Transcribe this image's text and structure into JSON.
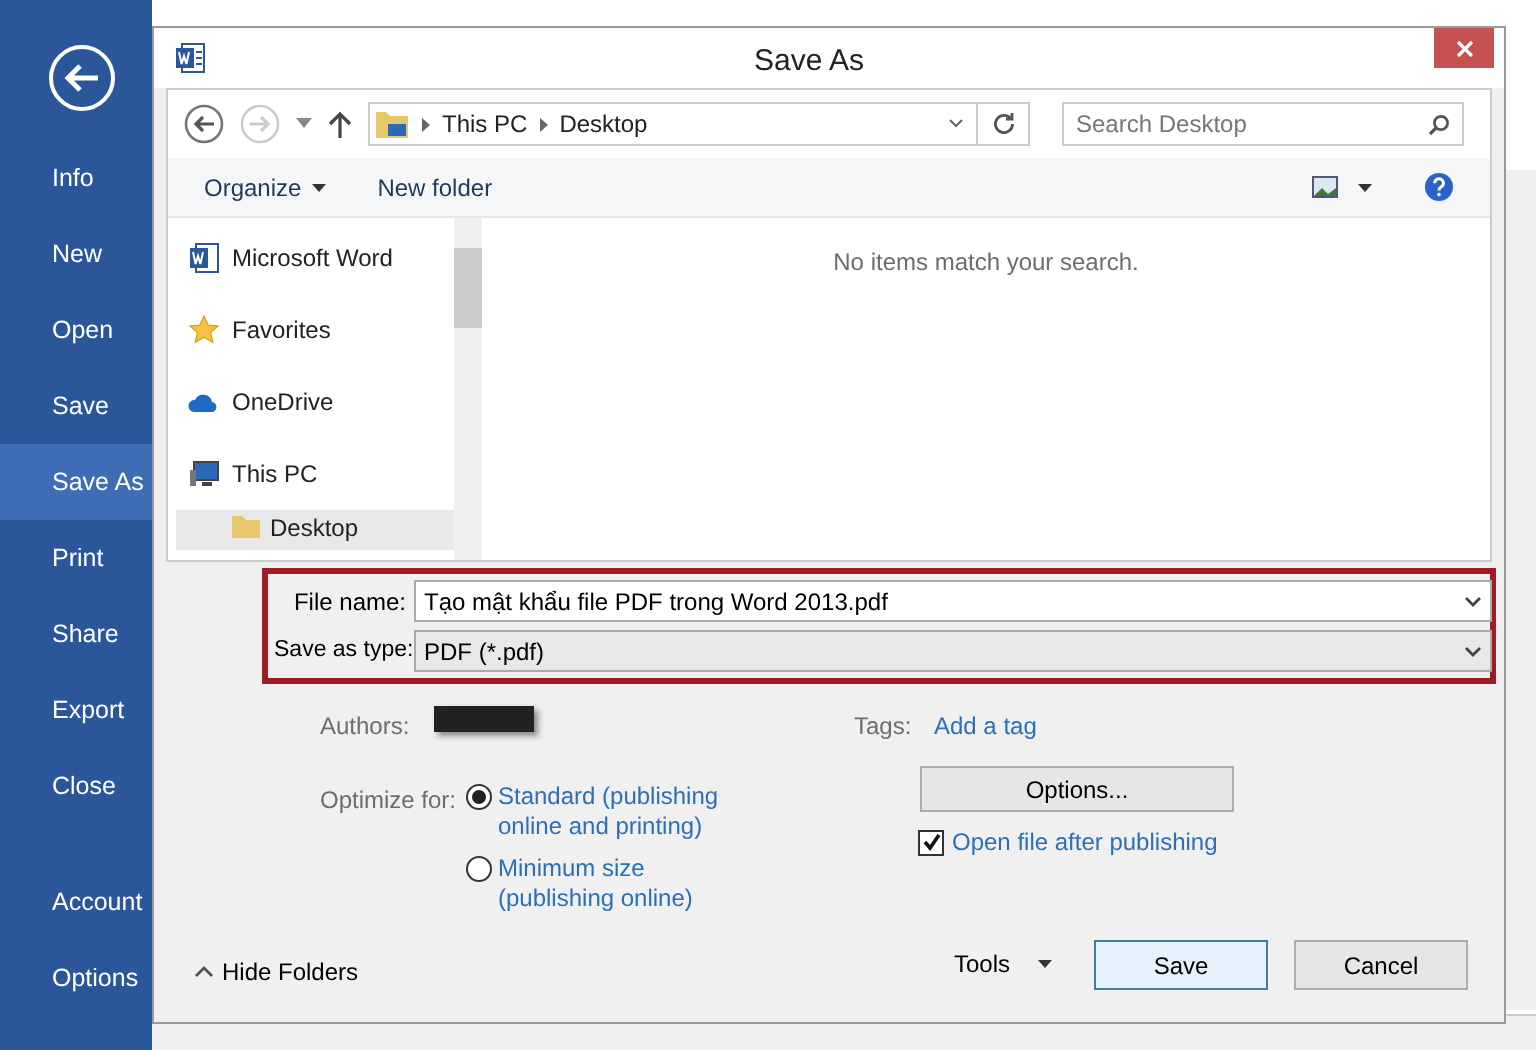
{
  "backstage": {
    "items": [
      {
        "label": "Info",
        "selected": false
      },
      {
        "label": "New",
        "selected": false
      },
      {
        "label": "Open",
        "selected": false
      },
      {
        "label": "Save",
        "selected": false
      },
      {
        "label": "Save As",
        "selected": true
      },
      {
        "label": "Print",
        "selected": false
      },
      {
        "label": "Share",
        "selected": false
      },
      {
        "label": "Export",
        "selected": false
      },
      {
        "label": "Close",
        "selected": false
      }
    ],
    "bottom_items": [
      {
        "label": "Account",
        "selected": false
      },
      {
        "label": "Options",
        "selected": false
      }
    ]
  },
  "dialog": {
    "title": "Save As",
    "breadcrumb": [
      "This PC",
      "Desktop"
    ],
    "search": {
      "placeholder": "Search Desktop"
    },
    "toolbar": [
      "Organize",
      "New folder"
    ],
    "nav": [
      {
        "label": "Microsoft Word",
        "kind": "word"
      },
      {
        "label": "Favorites",
        "kind": "star"
      },
      {
        "label": "OneDrive",
        "kind": "cloud"
      },
      {
        "label": "This PC",
        "kind": "pc"
      },
      {
        "label": "Desktop",
        "kind": "folder"
      }
    ],
    "empty_message": "No items match your search.",
    "file_name": {
      "label": "File name:",
      "value": "Tạo mật khẩu file PDF trong Word 2013.pdf"
    },
    "save_type": {
      "label": "Save as type:",
      "value": "PDF (*.pdf)"
    },
    "authors_label": "Authors:",
    "tags": {
      "label": "Tags:",
      "link": "Add a tag"
    },
    "optimize": {
      "label": "Optimize for:",
      "options": [
        {
          "label": "Standard (publishing online and printing)",
          "selected": true
        },
        {
          "label": "Minimum size (publishing online)",
          "selected": false
        }
      ]
    },
    "options_button": "Options...",
    "open_after": {
      "label": "Open file after publishing",
      "checked": true
    },
    "hide_folders": "Hide Folders",
    "tools": "Tools",
    "buttons": [
      "Save",
      "Cancel"
    ]
  }
}
